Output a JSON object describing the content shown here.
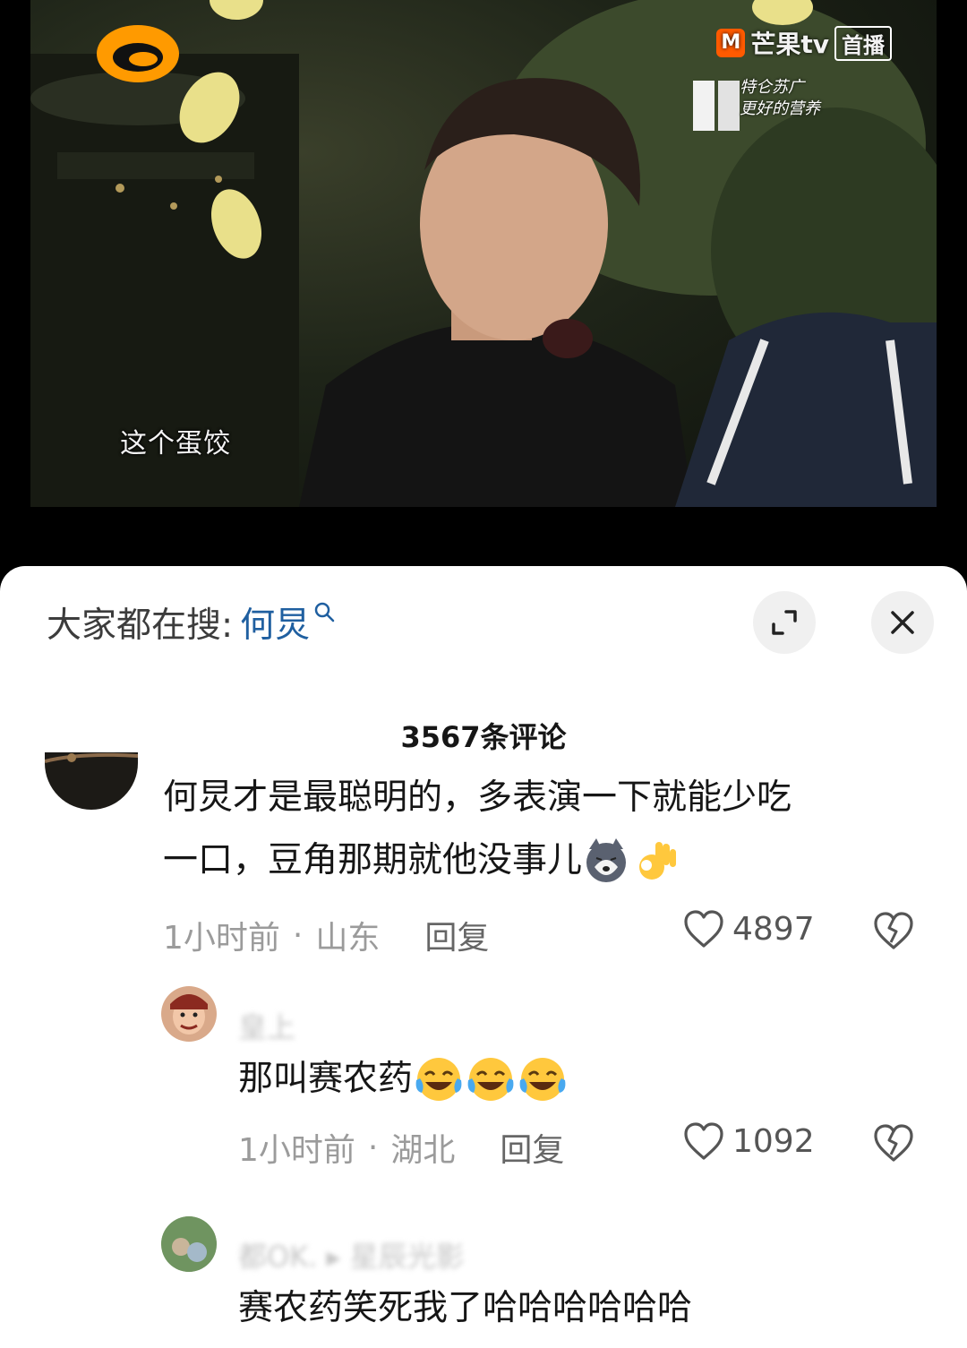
{
  "video": {
    "subtitle": "这个蛋饺",
    "watermark_brand": "芒果tv",
    "watermark_live": "首播",
    "sponsor_line1": "特仑苏广",
    "sponsor_line2": "更好的营养"
  },
  "sheet": {
    "search_label": "大家都在搜:",
    "search_keyword": "何炅",
    "comment_count": "3567条评论"
  },
  "comments": [
    {
      "text_line1": "何炅才是最聪明的，多表演一下就能少吃",
      "text_line2": "一口，豆角那期就他没事儿",
      "time": "1小时前",
      "location": "山东",
      "reply": "回复",
      "likes": "4897"
    },
    {
      "username": "皇上",
      "text": "那叫赛农药",
      "time": "1小时前",
      "location": "湖北",
      "reply": "回复",
      "likes": "1092"
    },
    {
      "username": "都OK. ▸ 星辰光影",
      "text": "赛农药笑死我了哈哈哈哈哈哈"
    }
  ],
  "icons": {
    "search": "search-icon",
    "expand": "expand-icon",
    "close": "close-icon",
    "like": "heart-outline-icon",
    "dislike": "broken-heart-icon",
    "emoji_husky": "husky-emoji-icon",
    "emoji_ok": "ok-hand-emoji-icon",
    "emoji_tears": "tears-of-joy-emoji-icon"
  },
  "colors": {
    "keyword": "#1f5fa0",
    "meta": "#9b9b9b",
    "logo_orange": "#ff9a00"
  }
}
